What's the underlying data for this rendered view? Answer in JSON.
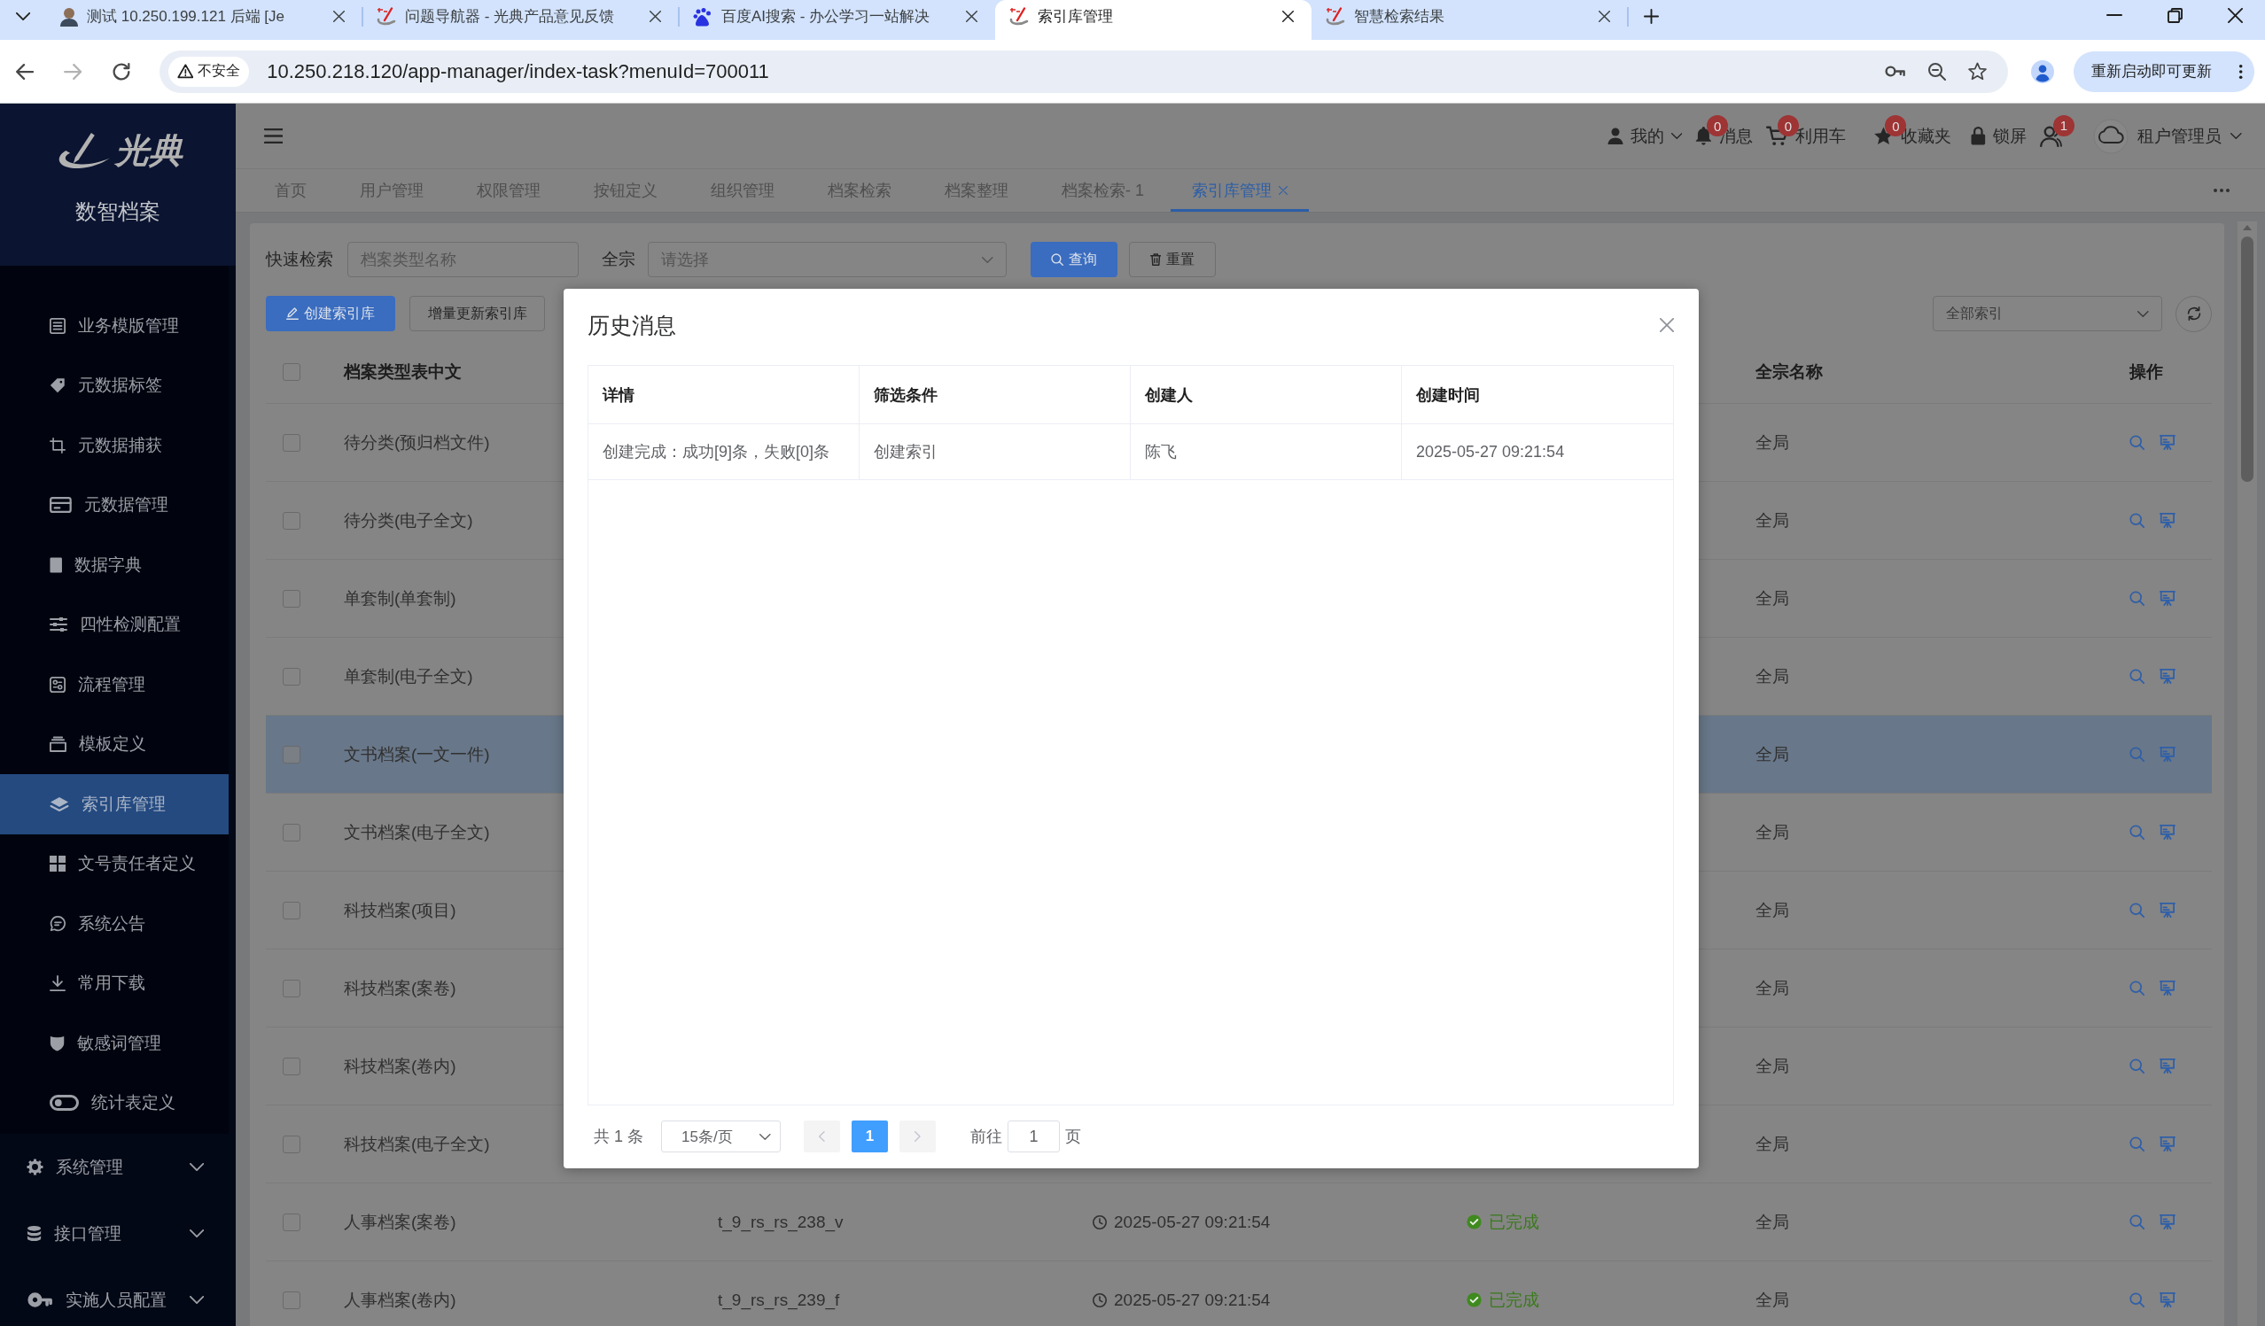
{
  "browser": {
    "tabs": [
      {
        "title": "测试 10.250.199.121 后端 [Je",
        "selected": false
      },
      {
        "title": "问题导航器 - 光典产品意见反馈",
        "selected": false
      },
      {
        "title": "百度AI搜索 - 办公学习一站解决",
        "selected": false
      },
      {
        "title": "索引库管理",
        "selected": true
      },
      {
        "title": "智慧检索结果",
        "selected": false
      }
    ],
    "address_bar": {
      "security_label": "不安全",
      "url": "10.250.218.120/app-manager/index-task?menuId=700011"
    },
    "update_button": "重新启动即可更新"
  },
  "sidebar": {
    "logo": "光典",
    "subtitle": "数智档案",
    "items": [
      {
        "label": "业务模版管理",
        "selected": false
      },
      {
        "label": "元数据标签",
        "selected": false
      },
      {
        "label": "元数据捕获",
        "selected": false
      },
      {
        "label": "元数据管理",
        "selected": false
      },
      {
        "label": "数据字典",
        "selected": false
      },
      {
        "label": "四性检测配置",
        "selected": false
      },
      {
        "label": "流程管理",
        "selected": false
      },
      {
        "label": "模板定义",
        "selected": false
      },
      {
        "label": "索引库管理",
        "selected": true
      },
      {
        "label": "文号责任者定义",
        "selected": false
      },
      {
        "label": "系统公告",
        "selected": false
      },
      {
        "label": "常用下载",
        "selected": false
      },
      {
        "label": "敏感词管理",
        "selected": false
      },
      {
        "label": "统计表定义",
        "selected": false
      }
    ],
    "groups": [
      {
        "label": "系统管理",
        "expanded": false
      },
      {
        "label": "接口管理",
        "expanded": false
      },
      {
        "label": "实施人员配置",
        "expanded": false
      }
    ]
  },
  "header": {
    "user_menu": "我的",
    "links": [
      {
        "label": "消息",
        "badge": "0"
      },
      {
        "label": "利用车",
        "badge": "0"
      },
      {
        "label": "收藏夹",
        "badge": "0"
      },
      {
        "label": "锁屏"
      }
    ],
    "user_badge": "1",
    "tenant_menu": "租户管理员"
  },
  "page_tabs": [
    {
      "label": "首页",
      "selected": false
    },
    {
      "label": "用户管理",
      "selected": false
    },
    {
      "label": "权限管理",
      "selected": false
    },
    {
      "label": "按钮定义",
      "selected": false
    },
    {
      "label": "组织管理",
      "selected": false
    },
    {
      "label": "档案检索",
      "selected": false
    },
    {
      "label": "档案整理",
      "selected": false
    },
    {
      "label": "档案检索- 1",
      "selected": false
    },
    {
      "label": "索引库管理",
      "selected": true
    }
  ],
  "filters": {
    "quick_search": {
      "label": "快速检索",
      "placeholder": "档案类型名称"
    },
    "fonds": {
      "label": "全宗",
      "placeholder": "请选择"
    },
    "search_button": "查询",
    "reset_button": "重置"
  },
  "toolbar": {
    "create_button": "创建索引库",
    "incremental_button": "增量更新索引库",
    "index_select": "全部索引"
  },
  "table": {
    "header_checked": false,
    "columns": {
      "name": "档案类型表中文",
      "fonds": "全宗名称",
      "actions": "操作"
    },
    "rows": [
      {
        "name": "待分类(预归档文件)",
        "fonds": "全局",
        "checked": false,
        "selected": false
      },
      {
        "name": "待分类(电子全文)",
        "fonds": "全局",
        "checked": false,
        "selected": false
      },
      {
        "name": "单套制(单套制)",
        "fonds": "全局",
        "checked": false,
        "selected": false
      },
      {
        "name": "单套制(电子全文)",
        "fonds": "全局",
        "checked": false,
        "selected": false
      },
      {
        "name": "文书档案(一文一件)",
        "fonds": "全局",
        "checked": false,
        "selected": true
      },
      {
        "name": "文书档案(电子全文)",
        "fonds": "全局",
        "checked": false,
        "selected": false
      },
      {
        "name": "科技档案(项目)",
        "fonds": "全局",
        "checked": false,
        "selected": false
      },
      {
        "name": "科技档案(案卷)",
        "fonds": "全局",
        "checked": false,
        "selected": false
      },
      {
        "name": "科技档案(卷内)",
        "fonds": "全局",
        "checked": false,
        "selected": false
      },
      {
        "name": "科技档案(电子全文)",
        "fonds": "全局",
        "checked": false,
        "selected": false
      },
      {
        "name": "人事档案(案卷)",
        "column_3": "t_9_rs_rs_238_v",
        "column_4": "2025-05-27 09:21:54",
        "column_5": "已完成",
        "fonds": "全局",
        "checked": false,
        "selected": false
      },
      {
        "name": "人事档案(卷内)",
        "column_3": "t_9_rs_rs_239_f",
        "column_4": "2025-05-27 09:21:54",
        "column_5": "已完成",
        "fonds": "全局",
        "checked": false,
        "selected": false
      }
    ]
  },
  "dialog": {
    "title": "历史消息",
    "columns": [
      "详情",
      "筛选条件",
      "创建人",
      "创建时间"
    ],
    "rows": [
      [
        "创建完成：成功[9]条，失败[0]条",
        "创建索引",
        "陈飞",
        "2025-05-27 09:21:54"
      ]
    ],
    "pagination": {
      "total": "共 1 条",
      "page_size": "15条/页",
      "prev_disabled": true,
      "pages": [
        {
          "label": "1",
          "selected": true
        }
      ],
      "next_disabled": true,
      "goto_label": "前往",
      "goto_value": "1",
      "goto_unit": "页"
    }
  }
}
